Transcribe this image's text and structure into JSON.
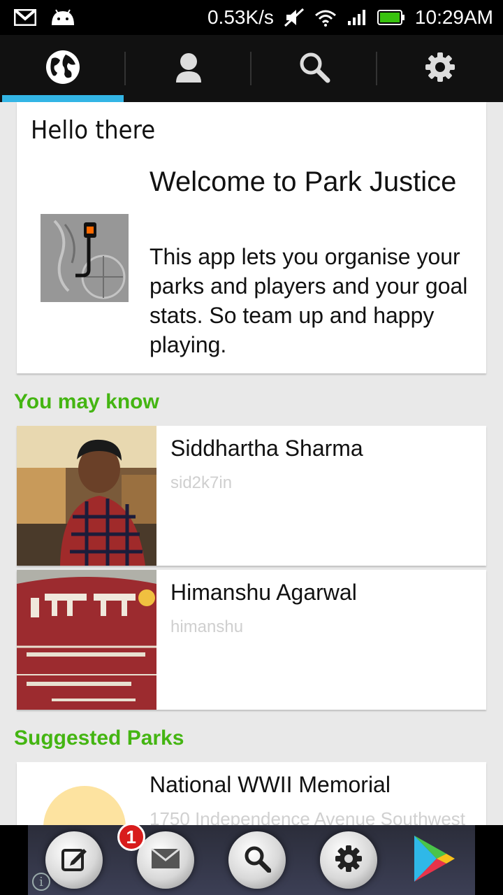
{
  "status_bar": {
    "speed": "0.53K/s",
    "time": "10:29AM",
    "icons": [
      "gmail-icon",
      "android-icon",
      "mute-icon",
      "wifi-icon",
      "signal-icon",
      "battery-icon"
    ]
  },
  "tabs": [
    {
      "name": "globe-icon",
      "active": true
    },
    {
      "name": "person-icon",
      "active": false
    },
    {
      "name": "search-icon",
      "active": false
    },
    {
      "name": "gear-icon",
      "active": false
    }
  ],
  "colors": {
    "accent": "#33b5e5",
    "section": "#44b512"
  },
  "welcome": {
    "greeting": "Hello there",
    "title": "Welcome to Park Justice",
    "description": "This app lets you organise your parks and players and your goal stats. So team up and happy playing."
  },
  "you_may_know": {
    "title": "You may know",
    "people": [
      {
        "name": "Siddhartha Sharma",
        "handle": "sid2k7in"
      },
      {
        "name": "Himanshu Agarwal",
        "handle": "himanshu"
      }
    ]
  },
  "suggested_parks": {
    "title": "Suggested Parks",
    "parks": [
      {
        "name": "National WWII Memorial",
        "address": "1750 Independence Avenue Southwest"
      }
    ]
  },
  "ad_bar": {
    "badge_count": "1",
    "buttons": [
      "edit-icon",
      "mail-icon",
      "search-icon",
      "gear-icon",
      "play-store-icon"
    ]
  }
}
